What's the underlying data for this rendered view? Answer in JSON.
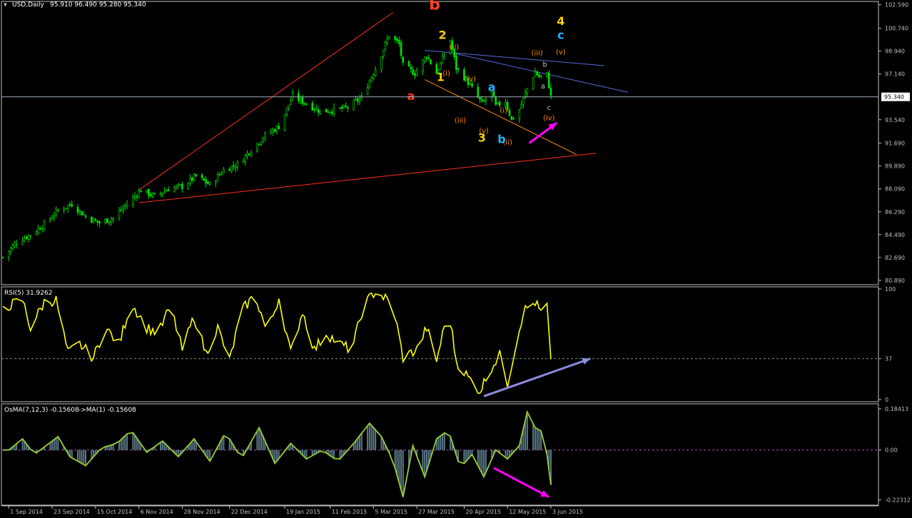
{
  "header": {
    "symbol_label": "USD,Daily",
    "ohlc": "95.910 96.490 95.280 95.340"
  },
  "colors": {
    "background": "#000000",
    "axis": "#c0c0c0",
    "candle_up": "#00e000",
    "candle_down": "#00e000",
    "rsi_line": "#ffff00",
    "osma_line": "#9acd32",
    "osma_hist": "#5a7a8a",
    "price_line": "#a0b0c0",
    "trend_red": "#ff3020",
    "trend_orange": "#ff8c00",
    "trend_blue": "#5a6ad8",
    "arrow_magenta": "#ff00ff",
    "arrow_lavender": "#8c8cdc"
  },
  "chart_data": [
    {
      "type": "line",
      "panel": "price",
      "title": "USD,Daily",
      "current_value": "95.340",
      "y_ticks": [
        "102.590",
        "100.740",
        "98.940",
        "97.140",
        "95.340",
        "93.540",
        "91.690",
        "89.890",
        "88.090",
        "86.290",
        "84.490",
        "82.690",
        "80.890"
      ],
      "ylim": [
        80.6,
        102.8
      ],
      "x_ticks": [
        "1 Sep 2014",
        "23 Sep 2014",
        "15 Oct 2014",
        "6 Nov 2014",
        "28 Nov 2014",
        "22 Dec 2014",
        "19 Jan 2015",
        "11 Feb 2015",
        "5 Mar 2015",
        "27 Mar 2015",
        "20 Apr 2015",
        "12 May 2015",
        "3 Jun 2015"
      ],
      "x_dates": [
        "2014-09-01",
        "2014-09-23",
        "2014-10-15",
        "2014-11-06",
        "2014-11-28",
        "2014-12-22",
        "2015-01-19",
        "2015-02-11",
        "2015-03-05",
        "2015-03-27",
        "2015-04-20",
        "2015-05-12",
        "2015-06-03"
      ],
      "x_range": [
        "2014-08-29",
        "2015-06-03"
      ],
      "close_keypoints": [
        [
          "2014-08-29",
          82.7
        ],
        [
          "2014-09-05",
          83.9
        ],
        [
          "2014-09-12",
          84.5
        ],
        [
          "2014-09-19",
          85.3
        ],
        [
          "2014-09-26",
          86.4
        ],
        [
          "2014-10-03",
          86.9
        ],
        [
          "2014-10-10",
          85.9
        ],
        [
          "2014-10-17",
          85.4
        ],
        [
          "2014-10-24",
          85.8
        ],
        [
          "2014-10-31",
          86.9
        ],
        [
          "2014-11-07",
          88.0
        ],
        [
          "2014-11-14",
          87.5
        ],
        [
          "2014-11-21",
          88.1
        ],
        [
          "2014-11-28",
          88.3
        ],
        [
          "2014-12-05",
          89.1
        ],
        [
          "2014-12-12",
          88.4
        ],
        [
          "2014-12-19",
          89.6
        ],
        [
          "2014-12-26",
          90.0
        ],
        [
          "2015-01-02",
          91.2
        ],
        [
          "2015-01-09",
          92.3
        ],
        [
          "2015-01-16",
          93.0
        ],
        [
          "2015-01-23",
          95.4
        ],
        [
          "2015-01-30",
          94.8
        ],
        [
          "2015-02-06",
          94.2
        ],
        [
          "2015-02-13",
          94.3
        ],
        [
          "2015-02-20",
          94.5
        ],
        [
          "2015-02-27",
          95.3
        ],
        [
          "2015-03-06",
          97.6
        ],
        [
          "2015-03-13",
          100.2
        ],
        [
          "2015-03-18",
          99.5
        ],
        [
          "2015-03-20",
          97.8
        ],
        [
          "2015-03-26",
          97.2
        ],
        [
          "2015-04-01",
          98.6
        ],
        [
          "2015-04-06",
          97.2
        ],
        [
          "2015-04-13",
          99.8
        ],
        [
          "2015-04-16",
          97.6
        ],
        [
          "2015-04-20",
          96.9
        ],
        [
          "2015-04-24",
          96.0
        ],
        [
          "2015-04-29",
          94.8
        ],
        [
          "2015-05-04",
          95.7
        ],
        [
          "2015-05-06",
          94.6
        ],
        [
          "2015-05-11",
          95.0
        ],
        [
          "2015-05-14",
          93.5
        ],
        [
          "2015-05-18",
          94.3
        ],
        [
          "2015-05-22",
          96.0
        ],
        [
          "2015-05-26",
          97.3
        ],
        [
          "2015-05-28",
          96.9
        ],
        [
          "2015-06-01",
          97.1
        ],
        [
          "2015-06-03",
          95.34
        ]
      ],
      "annotations": [
        {
          "text": "b",
          "date": "2015-04-05",
          "y": 102.2,
          "color": "#ff4020",
          "size": "big"
        },
        {
          "text": "a",
          "date": "2015-03-24",
          "y": 95.1,
          "color": "#ff4020",
          "size": "big"
        },
        {
          "text": "2",
          "date": "2015-04-09",
          "y": 99.9,
          "color": "#ffd000",
          "size": "big"
        },
        {
          "text": "(ii)",
          "date": "2015-04-15",
          "y": 99.1,
          "color": "#ff8c00",
          "size": "small"
        },
        {
          "text": "1",
          "date": "2015-04-08",
          "y": 96.6,
          "color": "#ffd000",
          "size": "big"
        },
        {
          "text": "(i)",
          "date": "2015-04-11",
          "y": 97.0,
          "color": "#ff8c00",
          "size": "small"
        },
        {
          "text": "(iv)",
          "date": "2015-04-23",
          "y": 96.6,
          "color": "#ff8c00",
          "size": "small"
        },
        {
          "text": "(iii)",
          "date": "2015-04-18",
          "y": 93.3,
          "color": "#ff8c00",
          "size": "small"
        },
        {
          "text": "(v)",
          "date": "2015-04-30",
          "y": 92.5,
          "color": "#ff8c00",
          "size": "small"
        },
        {
          "text": "3",
          "date": "2015-04-29",
          "y": 91.8,
          "color": "#ffd000",
          "size": "big"
        },
        {
          "text": "(i)",
          "date": "2015-05-10",
          "y": 94.1,
          "color": "#ff8c00",
          "size": "small"
        },
        {
          "text": "(ii)",
          "date": "2015-05-12",
          "y": 91.6,
          "color": "#ff8c00",
          "size": "small"
        },
        {
          "text": "a",
          "date": "2015-05-04",
          "y": 95.8,
          "color": "#1eb4ff",
          "size": "big"
        },
        {
          "text": "b",
          "date": "2015-05-09",
          "y": 91.7,
          "color": "#1eb4ff",
          "size": "big"
        },
        {
          "text": "(iii)",
          "date": "2015-05-27",
          "y": 98.6,
          "color": "#ff8c00",
          "size": "small"
        },
        {
          "text": "b",
          "date": "2015-05-31",
          "y": 97.7,
          "color": "#c0c0c0",
          "size": "small"
        },
        {
          "text": "a",
          "date": "2015-05-30",
          "y": 96.0,
          "color": "#c0c0c0",
          "size": "small"
        },
        {
          "text": "c",
          "date": "2015-06-02",
          "y": 94.3,
          "color": "#c0c0c0",
          "size": "small"
        },
        {
          "text": "(iv)",
          "date": "2015-06-02",
          "y": 93.5,
          "color": "#ff8c00",
          "size": "small"
        },
        {
          "text": "4",
          "date": "2015-06-08",
          "y": 101.0,
          "color": "#ffd000",
          "size": "big"
        },
        {
          "text": "c",
          "date": "2015-06-08",
          "y": 99.9,
          "color": "#1eb4ff",
          "size": "big"
        },
        {
          "text": "(v)",
          "date": "2015-06-08",
          "y": 98.7,
          "color": "#ff8c00",
          "size": "small"
        }
      ],
      "trendlines": [
        {
          "color": "#ff3020",
          "from": [
            "2014-11-06",
            88.0
          ],
          "to": [
            "2015-03-15",
            102.0
          ]
        },
        {
          "color": "#ff3020",
          "from": [
            "2014-11-06",
            87.0
          ],
          "to": [
            "2015-06-26",
            90.9
          ]
        },
        {
          "color": "#ff8c00",
          "from": [
            "2015-03-31",
            96.7
          ],
          "to": [
            "2015-06-16",
            90.8
          ]
        },
        {
          "color": "#5a6ad8",
          "from": [
            "2015-03-31",
            99.0
          ],
          "to": [
            "2015-06-30",
            97.8
          ]
        },
        {
          "color": "#5a6ad8",
          "from": [
            "2015-04-14",
            98.8
          ],
          "to": [
            "2015-07-12",
            95.7
          ]
        }
      ],
      "arrows": [
        {
          "color": "#ff00ff",
          "from": [
            "2015-05-23",
            91.7
          ],
          "to": [
            "2015-06-06",
            93.3
          ]
        }
      ]
    },
    {
      "type": "line",
      "panel": "rsi",
      "title": "RSI(5) 31.9262",
      "y_ticks": [
        "100",
        "37",
        "0"
      ],
      "ylim": [
        0,
        100
      ],
      "level": 37,
      "values_keypoints": [
        [
          "2014-09-01",
          85
        ],
        [
          "2014-09-08",
          90
        ],
        [
          "2014-09-12",
          65
        ],
        [
          "2014-09-19",
          88
        ],
        [
          "2014-09-25",
          90
        ],
        [
          "2014-10-01",
          42
        ],
        [
          "2014-10-07",
          50
        ],
        [
          "2014-10-14",
          38
        ],
        [
          "2014-10-20",
          65
        ],
        [
          "2014-10-27",
          50
        ],
        [
          "2014-11-02",
          88
        ],
        [
          "2014-11-10",
          65
        ],
        [
          "2014-11-16",
          60
        ],
        [
          "2014-11-22",
          85
        ],
        [
          "2014-11-28",
          45
        ],
        [
          "2014-12-04",
          75
        ],
        [
          "2014-12-10",
          42
        ],
        [
          "2014-12-16",
          65
        ],
        [
          "2014-12-22",
          35
        ],
        [
          "2014-12-28",
          80
        ],
        [
          "2015-01-04",
          95
        ],
        [
          "2015-01-10",
          60
        ],
        [
          "2015-01-16",
          92
        ],
        [
          "2015-01-22",
          42
        ],
        [
          "2015-01-28",
          80
        ],
        [
          "2015-02-03",
          45
        ],
        [
          "2015-02-09",
          60
        ],
        [
          "2015-02-16",
          50
        ],
        [
          "2015-02-22",
          45
        ],
        [
          "2015-02-28",
          85
        ],
        [
          "2015-03-06",
          98
        ],
        [
          "2015-03-12",
          90
        ],
        [
          "2015-03-16",
          75
        ],
        [
          "2015-03-20",
          38
        ],
        [
          "2015-03-27",
          45
        ],
        [
          "2015-04-01",
          65
        ],
        [
          "2015-04-06",
          35
        ],
        [
          "2015-04-12",
          82
        ],
        [
          "2015-04-16",
          35
        ],
        [
          "2015-04-22",
          20
        ],
        [
          "2015-04-28",
          8
        ],
        [
          "2015-05-04",
          30
        ],
        [
          "2015-05-08",
          40
        ],
        [
          "2015-05-12",
          15
        ],
        [
          "2015-05-20",
          80
        ],
        [
          "2015-05-26",
          88
        ],
        [
          "2015-05-30",
          75
        ],
        [
          "2015-06-01",
          85
        ],
        [
          "2015-06-03",
          31.9
        ]
      ],
      "arrows": [
        {
          "color": "#8c8cdc",
          "from": [
            "2015-04-30",
            3
          ],
          "to": [
            "2015-06-23",
            37
          ]
        }
      ]
    },
    {
      "type": "bar",
      "panel": "osma",
      "title": "OsMA(7,12,3) -0.15608",
      "title_ma": "->MA(1) -0.15608",
      "y_ticks": [
        "0.18413",
        "0.00",
        "-0.22312"
      ],
      "ylim": [
        -0.24,
        0.2
      ],
      "values_keypoints": [
        [
          "2014-09-01",
          0.0
        ],
        [
          "2014-09-08",
          0.05
        ],
        [
          "2014-09-14",
          -0.02
        ],
        [
          "2014-09-20",
          0.02
        ],
        [
          "2014-09-26",
          0.06
        ],
        [
          "2014-10-02",
          -0.03
        ],
        [
          "2014-10-10",
          -0.07
        ],
        [
          "2014-10-18",
          0.01
        ],
        [
          "2014-10-26",
          0.03
        ],
        [
          "2014-11-02",
          0.09
        ],
        [
          "2014-11-10",
          -0.01
        ],
        [
          "2014-11-18",
          0.04
        ],
        [
          "2014-11-26",
          -0.03
        ],
        [
          "2014-12-04",
          0.05
        ],
        [
          "2014-12-12",
          -0.05
        ],
        [
          "2014-12-20",
          0.08
        ],
        [
          "2014-12-28",
          -0.04
        ],
        [
          "2015-01-06",
          0.1
        ],
        [
          "2015-01-14",
          -0.06
        ],
        [
          "2015-01-22",
          0.03
        ],
        [
          "2015-01-30",
          -0.04
        ],
        [
          "2015-02-07",
          0.0
        ],
        [
          "2015-02-15",
          -0.05
        ],
        [
          "2015-02-23",
          0.03
        ],
        [
          "2015-03-03",
          0.12
        ],
        [
          "2015-03-09",
          0.06
        ],
        [
          "2015-03-15",
          -0.05
        ],
        [
          "2015-03-20",
          -0.21
        ],
        [
          "2015-03-25",
          0.02
        ],
        [
          "2015-03-31",
          -0.12
        ],
        [
          "2015-04-06",
          0.05
        ],
        [
          "2015-04-12",
          0.09
        ],
        [
          "2015-04-18",
          -0.08
        ],
        [
          "2015-04-24",
          -0.02
        ],
        [
          "2015-04-30",
          -0.12
        ],
        [
          "2015-05-06",
          0.0
        ],
        [
          "2015-05-12",
          -0.04
        ],
        [
          "2015-05-18",
          0.02
        ],
        [
          "2015-05-22",
          0.17
        ],
        [
          "2015-05-26",
          0.1
        ],
        [
          "2015-05-30",
          0.08
        ],
        [
          "2015-06-01",
          -0.02
        ],
        [
          "2015-06-03",
          -0.156
        ]
      ],
      "arrows": [
        {
          "color": "#ff00ff",
          "from": [
            "2015-05-05",
            -0.08
          ],
          "to": [
            "2015-06-02",
            -0.21
          ]
        }
      ]
    }
  ]
}
